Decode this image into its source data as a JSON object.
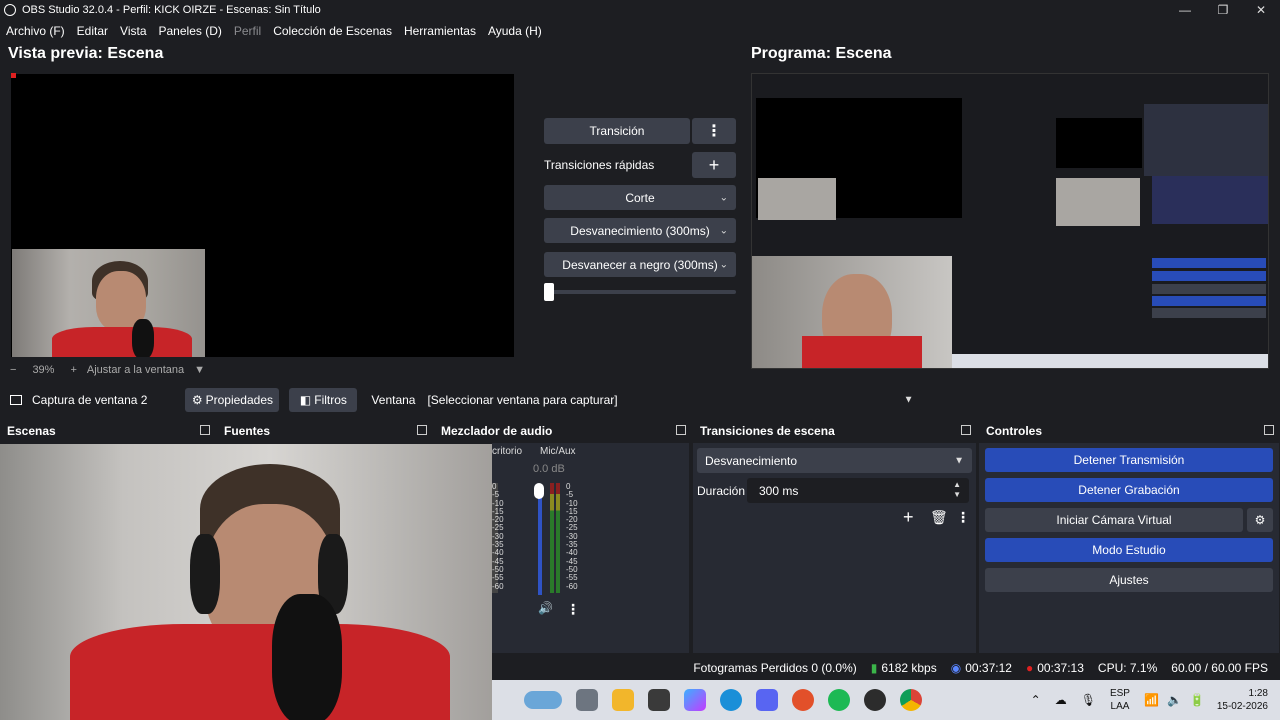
{
  "window": {
    "title": "OBS Studio 32.0.4 - Perfil: KICK OIRZE - Escenas: Sin Título",
    "controls": [
      "—",
      "❐",
      "✕"
    ]
  },
  "menu": [
    {
      "label": "Archivo (F)",
      "disabled": false
    },
    {
      "label": "Editar",
      "disabled": false
    },
    {
      "label": "Vista",
      "disabled": false
    },
    {
      "label": "Paneles (D)",
      "disabled": false
    },
    {
      "label": "Perfil",
      "disabled": true
    },
    {
      "label": "Colección de Escenas",
      "disabled": false
    },
    {
      "label": "Herramientas",
      "disabled": false
    },
    {
      "label": "Ayuda (H)",
      "disabled": false
    }
  ],
  "preview": {
    "title": "Vista previa: Escena",
    "zoom": "39%",
    "zoom_minus": "−",
    "zoom_plus": "+",
    "fit_label": "Ajustar a la ventana"
  },
  "program": {
    "title": "Programa: Escena"
  },
  "transition_panel": {
    "transition_button": "Transición",
    "quick_label": "Transiciones rápidas",
    "cut": "Corte",
    "fade": "Desvanecimiento (300ms)",
    "fade_black": "Desvanecer a negro (300ms)"
  },
  "source_toolbar": {
    "source_name": "Captura de ventana 2",
    "properties": "Propiedades",
    "filters": "Filtros",
    "window_label": "Ventana",
    "window_value": "[Seleccionar ventana para capturar]"
  },
  "docks": {
    "scenes": "Escenas",
    "sources": "Fuentes",
    "mixer": "Mezclador de audio",
    "transitions": "Transiciones de escena",
    "controls": "Controles"
  },
  "mixer": {
    "channel_cut": "critorio",
    "channel_name": "Mic/Aux",
    "level": "0.0 dB",
    "scale": [
      "0",
      "-5",
      "-10",
      "-15",
      "-20",
      "-25",
      "-30",
      "-35",
      "-40",
      "-45",
      "-50",
      "-55",
      "-60"
    ]
  },
  "scene_transitions": {
    "type": "Desvanecimiento",
    "duration_label": "Duración",
    "duration_value": "300 ms"
  },
  "controls": {
    "stop_stream": "Detener Transmisión",
    "stop_recording": "Detener Grabación",
    "virtual_cam": "Iniciar Cámara Virtual",
    "studio_mode": "Modo Estudio",
    "settings": "Ajustes"
  },
  "status": {
    "dropped": "Fotogramas Perdidos 0 (0.0%)",
    "bitrate": "6182 kbps",
    "stream_time": "00:37:12",
    "rec_time": "00:37:13",
    "cpu": "CPU: 7.1%",
    "fps": "60.00 / 60.00 FPS"
  },
  "taskbar": {
    "lang": "ESP",
    "lang2": "LAA",
    "time": "1:28",
    "date": "15-02-2026",
    "icons": [
      "widgets-icon",
      "task-view-icon",
      "file-explorer-icon",
      "store-icon",
      "copilot-icon",
      "edge-icon",
      "discord-icon",
      "ea-icon",
      "spotify-icon",
      "obs-icon",
      "chrome-icon"
    ]
  },
  "colors": {
    "accent_blue": "#284cb8",
    "panel_bg": "#272a33",
    "window_bg": "#1d1e22",
    "button_bg": "#3c404b"
  }
}
